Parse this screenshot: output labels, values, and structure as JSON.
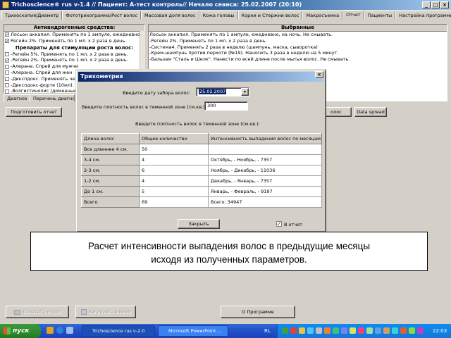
{
  "window": {
    "title": "Trichoscience® rus v-1.4 // Пациент: А-тест контроль// Начало сеанса: 25.02.2007 (20:10)",
    "buttons": [
      "_",
      "□",
      "×"
    ]
  },
  "tabs": [
    "Трихоскопия/Диаметр",
    "Фототрихограмма/Рост волос",
    "Массовая доля волос",
    "Кожа головы",
    "Корни и Стержни волос",
    "Макросъемка",
    "Отчет",
    "Пациенты",
    "Настройка программы"
  ],
  "left_panel": {
    "title": "Антиандрогенные средства:",
    "antiandrogen_items": [
      {
        "checked": true,
        "text": "Лосьон аккапил. Применять по 1 ампуле, ежедневно, на"
      },
      {
        "checked": true,
        "text": "Регейн 2%. Применять по 1 мл. х 2 раза в день."
      }
    ],
    "stimulants_title": "Препараты для стимуляции роста волос:",
    "stimulant_items": [
      {
        "checked": false,
        "text": "-Регейн 5%. Применять по 1 мл. х 2 раза в день."
      },
      {
        "checked": true,
        "text": "-Регейн 2%. Применять по 1 мл. х 2 раза в день."
      },
      {
        "checked": false,
        "text": "-Алерана. Спрей для мужчи"
      },
      {
        "checked": false,
        "text": "-Алерана. Спрей для жен"
      },
      {
        "checked": false,
        "text": "-Дикспдокс. Применять чер"
      },
      {
        "checked": false,
        "text": "-Дикспдокс-форте (10мл). П"
      },
      {
        "checked": false,
        "text": "-Волгистинолис (доменные"
      }
    ],
    "bottom_tabs": [
      "Диагноз",
      "Перечень диагнозо"
    ]
  },
  "right_panel": {
    "title": "Выбранные",
    "lines": [
      "Лосьон аккапил. Применять по 1 ампуле, ежедневно, на ночь. Не смывать.",
      "-Регейн 2%. Применять по 1 мл. х 2 раза в день.",
      "-Система4. Применять 2 раза в неделю (шампунь, маска, сыворотка)",
      "-Крем-шампунь против перхоти (№19). Наносить 3 раза в неделю на 5 минут.",
      "-Бальзам \"Сталь и Шелк\". Нанести по всей длине после мытья волос. Не смывать."
    ]
  },
  "toolbar": {
    "prepare_report": "Подготовить отчет",
    "hair_button": "олос",
    "data_spread": "Data spread"
  },
  "dialog": {
    "title": "Трихометрия",
    "date_label": "Введите дату забора волос:",
    "date_value": "25.02.2007",
    "density_label": "Введите плотность волос в теменной зоне (см.кв.):",
    "density_value": "300",
    "grid_caption": "Введите плотность волос в теменной зоне (см.кв.):",
    "headers": [
      "Длина волос",
      "Общее количество",
      "Интенсивность выпадения волос по месяцам"
    ],
    "rows": [
      {
        "length": "Все длиннее 4 см.",
        "count": "50",
        "intensity": ""
      },
      {
        "length": "3-4 см.",
        "count": "4",
        "intensity": "Октябрь, - Ноябрь, - 7357"
      },
      {
        "length": "2-3 см.",
        "count": "6",
        "intensity": "Ноябрь, - Декабрь, - 11036"
      },
      {
        "length": "1-2 см.",
        "count": "4",
        "intensity": "Декабрь, - Январь, - 7357"
      },
      {
        "length": "До 1 см.",
        "count": "5",
        "intensity": "Январь, - Февраль, - 9197"
      },
      {
        "length": "Всего",
        "count": "69",
        "intensity": "Всего: 34947"
      }
    ],
    "close_label": "Закрыть",
    "report_label": "В отчет",
    "report_checked": true
  },
  "caption": {
    "line1": "Расчет интенсивности выпадения волос в предыдущие месяцы",
    "line2": "исходя из полученных параметров."
  },
  "footer": {
    "print_report": "Печатать отчет",
    "load_word": "Загрузить в Word",
    "about": "О Программе"
  },
  "taskbar": {
    "start": "пуск",
    "tasks": [
      "Trichoscience rus v-2.0",
      "Microsoft PowerPoint ..."
    ],
    "lang": "RL",
    "clock": "22:03"
  }
}
